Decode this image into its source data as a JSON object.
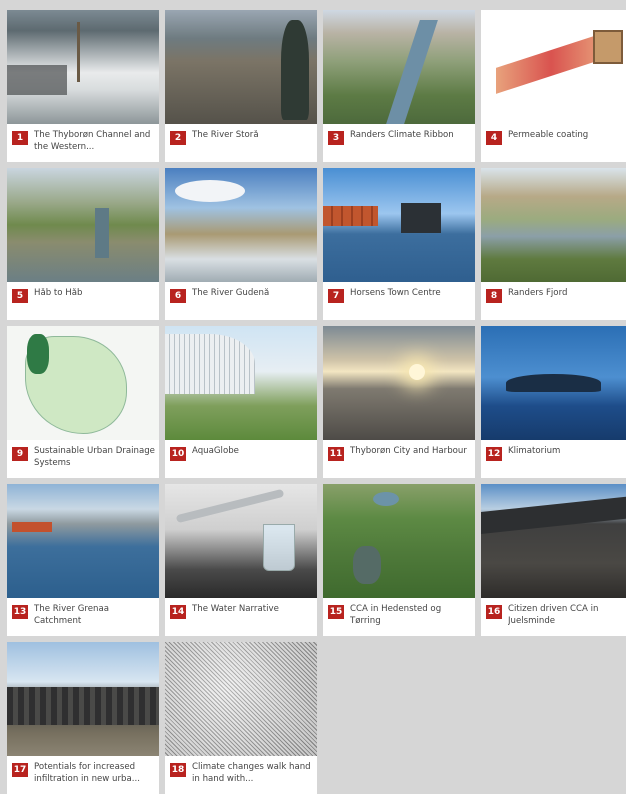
{
  "items": [
    {
      "num": "1",
      "title": "The Thyborøn Channel and the Western..."
    },
    {
      "num": "2",
      "title": "The River Storå"
    },
    {
      "num": "3",
      "title": "Randers Climate Ribbon"
    },
    {
      "num": "4",
      "title": "Permeable coating"
    },
    {
      "num": "5",
      "title": "Håb to Håb"
    },
    {
      "num": "6",
      "title": "The River Gudenå"
    },
    {
      "num": "7",
      "title": "Horsens Town Centre"
    },
    {
      "num": "8",
      "title": "Randers Fjord"
    },
    {
      "num": "9",
      "title": "Sustainable Urban Drainage Systems"
    },
    {
      "num": "10",
      "title": "AquaGlobe"
    },
    {
      "num": "11",
      "title": "Thyborøn City and Harbour"
    },
    {
      "num": "12",
      "title": "Klimatorium"
    },
    {
      "num": "13",
      "title": "The River Grenaa Catchment"
    },
    {
      "num": "14",
      "title": "The Water Narrative"
    },
    {
      "num": "15",
      "title": "CCA in Hedensted og Tørring"
    },
    {
      "num": "16",
      "title": "Citizen driven CCA in Juelsminde"
    },
    {
      "num": "17",
      "title": "Potentials for increased infiltration in new urba..."
    },
    {
      "num": "18",
      "title": "Climate changes walk hand in hand with..."
    }
  ],
  "colors": {
    "badge": "#b8231f",
    "background": "#d6d6d6",
    "card": "#ffffff"
  }
}
